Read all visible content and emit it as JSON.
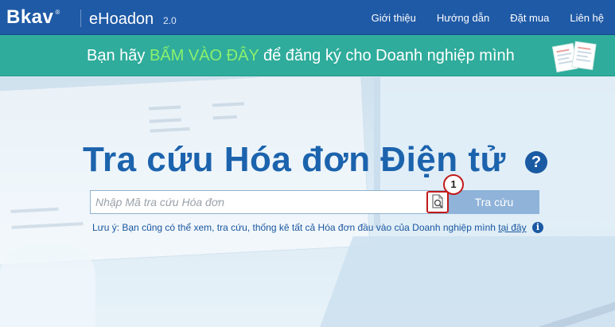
{
  "header": {
    "logo_brand": "Bkav",
    "logo_reg": "®",
    "product": "eHoadon",
    "version": "2.0",
    "nav": [
      {
        "label": "Giới thiệu"
      },
      {
        "label": "Hướng dẫn"
      },
      {
        "label": "Đặt mua"
      },
      {
        "label": "Liên hệ"
      }
    ]
  },
  "banner": {
    "prefix": "Bạn hãy ",
    "highlight": "BẤM VÀO ĐÂY",
    "suffix": " để đăng ký cho Doanh nghiệp mình"
  },
  "main": {
    "title": "Tra cứu Hóa đơn Điện tử",
    "help_symbol": "?",
    "search": {
      "placeholder": "Nhập Mã tra cứu Hóa đơn",
      "value": "",
      "button_label": "Tra cứu"
    },
    "step_badge": "1",
    "note": {
      "text": "Lưu ý: Bạn cũng có thể xem, tra cứu, thống kê tất cả Hóa đơn đầu vào của Doanh nghiệp mình ",
      "link": "tại đây",
      "info_symbol": "i"
    }
  },
  "colors": {
    "header_bg": "#1f5aa6",
    "banner_bg": "#2fac9b",
    "banner_highlight": "#8cf06e",
    "title": "#1c63ad",
    "search_button": "#8fb3d9",
    "annotation_red": "#c21a1a"
  },
  "icons": {
    "scan": "document-search-icon",
    "help": "question-circle-icon",
    "info": "info-circle-icon"
  }
}
